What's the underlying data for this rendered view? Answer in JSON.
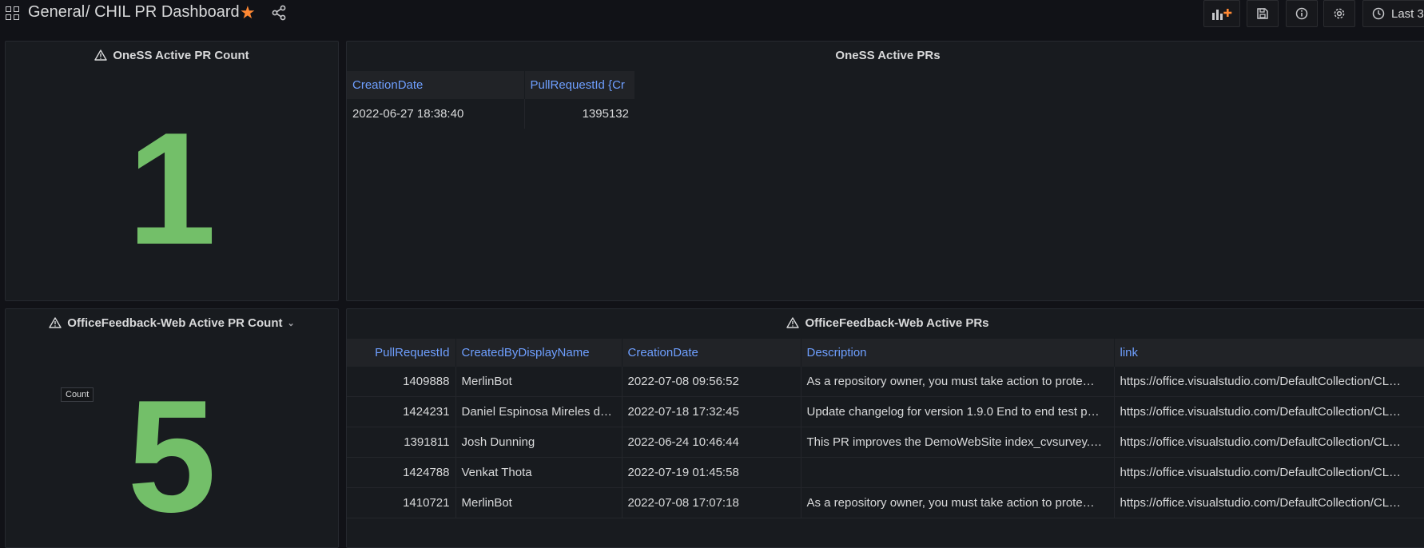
{
  "breadcrumb": {
    "folder": "General",
    "dashboard": "/ CHIL PR Dashboard"
  },
  "toolbar": {
    "time_range": "Last 3"
  },
  "colors": {
    "accent": "#ff8833",
    "stat": "#73bf69",
    "header_text": "#6e9fff"
  },
  "panels": {
    "oness_count": {
      "title": "OneSS Active PR Count",
      "value": "1"
    },
    "oness_prs": {
      "title": "OneSS Active PRs",
      "columns": [
        "CreationDate",
        "PullRequestId {Cr"
      ],
      "rows": [
        [
          "2022-06-27 18:38:40",
          "1395132"
        ]
      ]
    },
    "ofw_count": {
      "title": "OfficeFeedback-Web Active PR Count",
      "value": "5",
      "tooltip": "Count"
    },
    "ofw_prs": {
      "title": "OfficeFeedback-Web Active PRs",
      "columns": [
        "PullRequestId",
        "CreatedByDisplayName",
        "CreationDate",
        "Description",
        "link"
      ],
      "rows": [
        [
          "1409888",
          "MerlinBot",
          "2022-07-08 09:56:52",
          "As a repository owner, you must take action to prote…",
          "https://office.visualstudio.com/DefaultCollection/CL…"
        ],
        [
          "1424231",
          "Daniel Espinosa Mireles d…",
          "2022-07-18 17:32:45",
          "Update changelog for version 1.9.0 End to end test p…",
          "https://office.visualstudio.com/DefaultCollection/CL…"
        ],
        [
          "1391811",
          "Josh Dunning",
          "2022-06-24 10:46:44",
          "This PR improves the DemoWebSite index_cvsurvey.…",
          "https://office.visualstudio.com/DefaultCollection/CL…"
        ],
        [
          "1424788",
          "Venkat Thota",
          "2022-07-19 01:45:58",
          "",
          "https://office.visualstudio.com/DefaultCollection/CL…"
        ],
        [
          "1410721",
          "MerlinBot",
          "2022-07-08 17:07:18",
          "As a repository owner, you must take action to prote…",
          "https://office.visualstudio.com/DefaultCollection/CL…"
        ]
      ]
    }
  }
}
